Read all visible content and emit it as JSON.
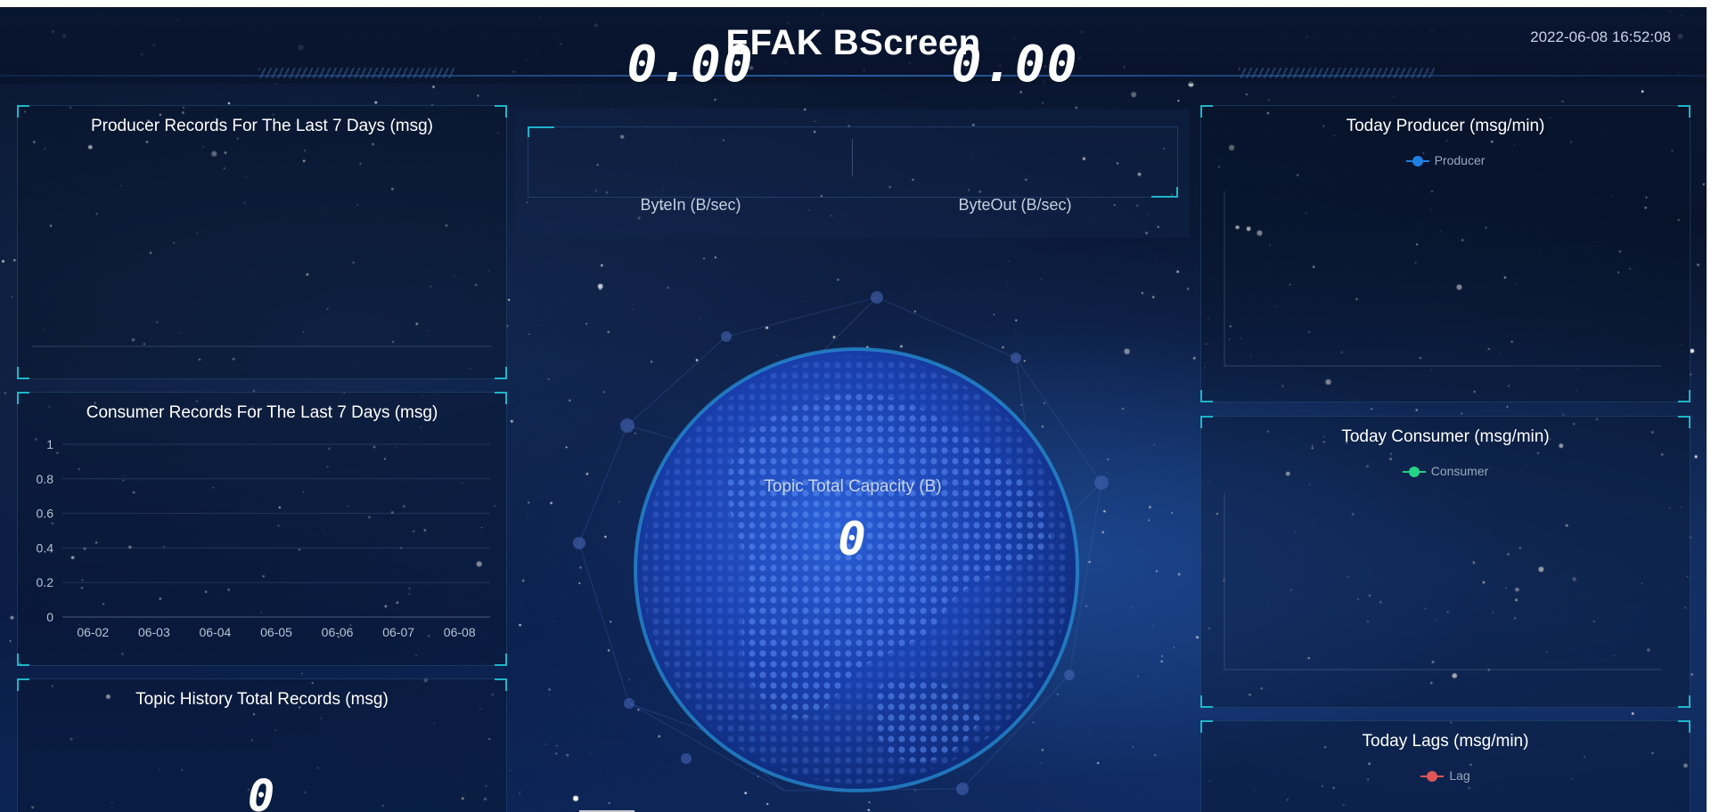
{
  "header": {
    "title": "EFAK BScreen",
    "datetime": "2022-06-08 16:52:08"
  },
  "kpis": {
    "byte_in": {
      "value": "0.00",
      "label": "ByteIn (B/sec)"
    },
    "byte_out": {
      "value": "0.00",
      "label": "ByteOut (B/sec)"
    }
  },
  "capacity": {
    "label": "Topic Total Capacity (B)",
    "value": "0"
  },
  "panels": {
    "producer_history": {
      "title": "Producer Records For The Last 7 Days (msg)"
    },
    "consumer_history": {
      "title": "Consumer Records For The Last 7 Days (msg)"
    },
    "topic_history": {
      "title": "Topic History Total Records (msg)",
      "value": "0"
    },
    "today_producer": {
      "title": "Today Producer (msg/min)",
      "legend": "Producer",
      "color": "#1e7fe0"
    },
    "today_consumer": {
      "title": "Today Consumer (msg/min)",
      "legend": "Consumer",
      "color": "#22d486"
    },
    "today_lags": {
      "title": "Today Lags (msg/min)",
      "legend": "Lag",
      "color": "#e05656"
    }
  },
  "chart_data": {
    "type": "line",
    "title": "Consumer Records For The Last 7 Days (msg)",
    "categories": [
      "06-02",
      "06-03",
      "06-04",
      "06-05",
      "06-06",
      "06-07",
      "06-08"
    ],
    "series": [],
    "yticks": [
      "0",
      "0.2",
      "0.4",
      "0.6",
      "0.8",
      "1"
    ],
    "ylim": [
      0,
      1
    ],
    "grid": true
  }
}
